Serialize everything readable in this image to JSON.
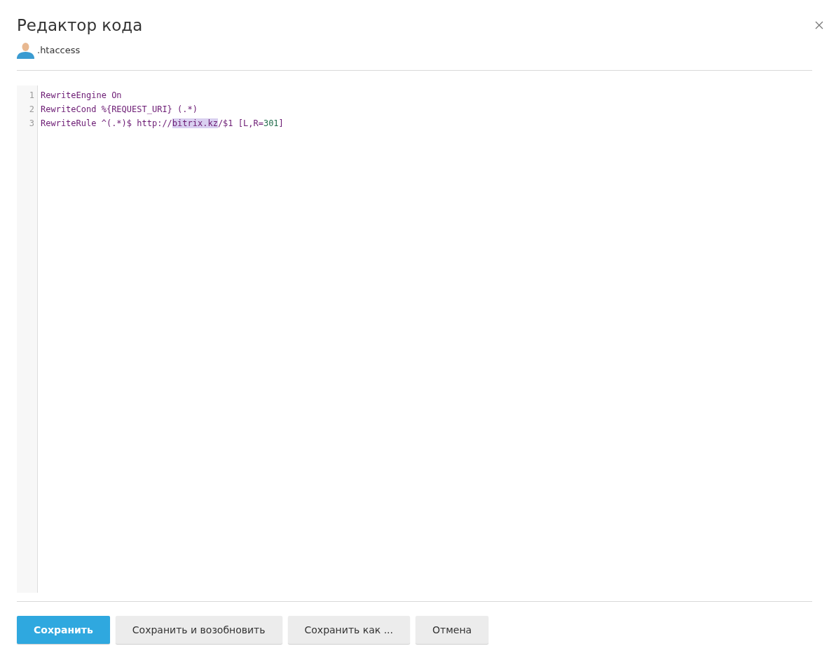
{
  "dialog": {
    "title": "Редактор кода",
    "file_name": ".htaccess"
  },
  "editor": {
    "lines": [
      {
        "number": "1",
        "tokens": [
          {
            "kind": "plain",
            "text": "RewriteEngine On"
          }
        ]
      },
      {
        "number": "2",
        "tokens": [
          {
            "kind": "plain",
            "text": "RewriteCond %{REQUEST_URI} (.*)"
          }
        ]
      },
      {
        "number": "3",
        "tokens": [
          {
            "kind": "plain",
            "text": "RewriteRule ^(.*)$ http://"
          },
          {
            "kind": "match",
            "text": "bitrix.kz"
          },
          {
            "kind": "plain",
            "text": "/$1 [L,R="
          },
          {
            "kind": "number",
            "text": "301"
          },
          {
            "kind": "plain",
            "text": "]"
          }
        ]
      }
    ]
  },
  "buttons": [
    {
      "label": "Сохранить",
      "kind": "primary"
    },
    {
      "label": "Сохранить и возобновить",
      "kind": "secondary"
    },
    {
      "label": "Сохранить как ...",
      "kind": "secondary"
    },
    {
      "label": "Отмена",
      "kind": "secondary"
    }
  ]
}
